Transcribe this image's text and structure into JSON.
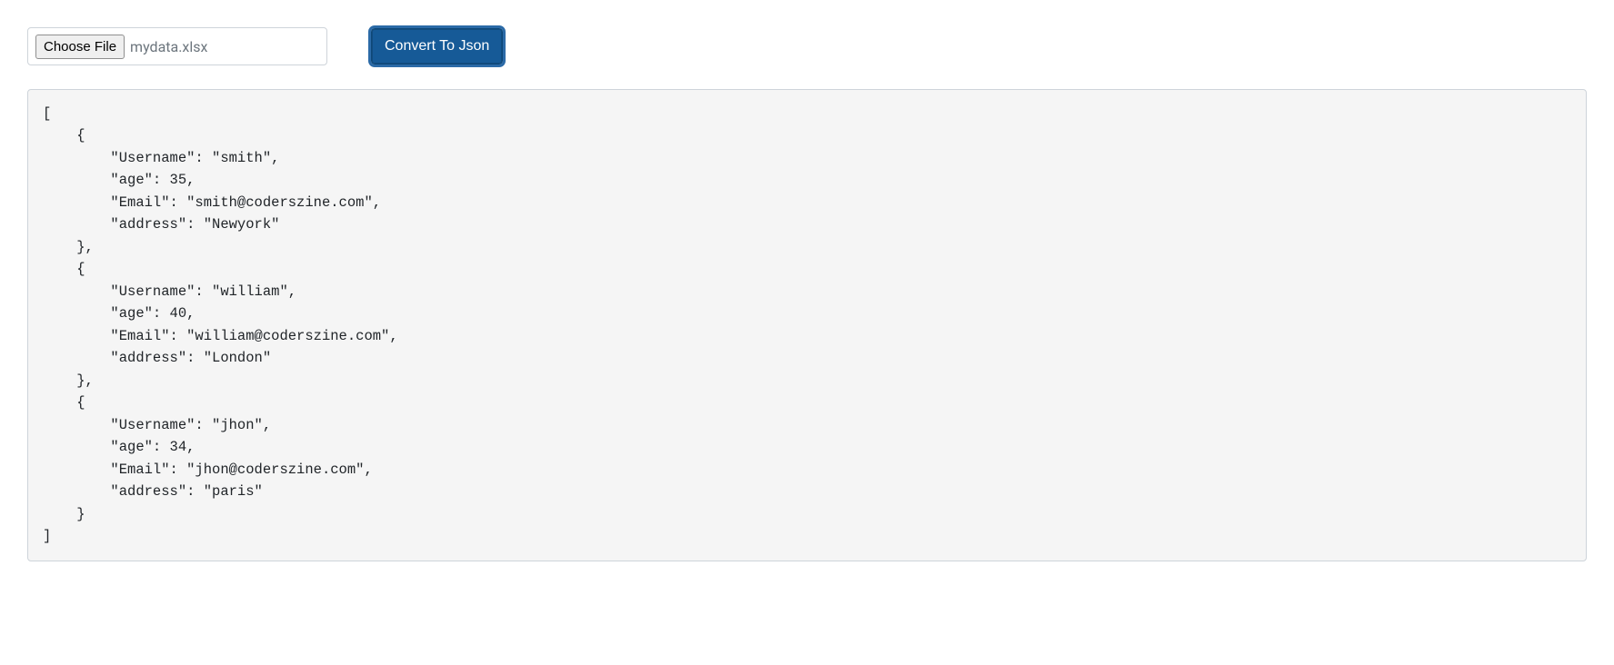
{
  "controls": {
    "choose_file_label": "Choose File",
    "selected_filename": "mydata.xlsx",
    "convert_button_label": "Convert To Json"
  },
  "output_records": [
    {
      "Username": "smith",
      "age": 35,
      "Email": "smith@coderszine.com",
      "address": "Newyork"
    },
    {
      "Username": "william",
      "age": 40,
      "Email": "william@coderszine.com",
      "address": "London"
    },
    {
      "Username": "jhon",
      "age": 34,
      "Email": "jhon@coderszine.com",
      "address": "paris"
    }
  ]
}
